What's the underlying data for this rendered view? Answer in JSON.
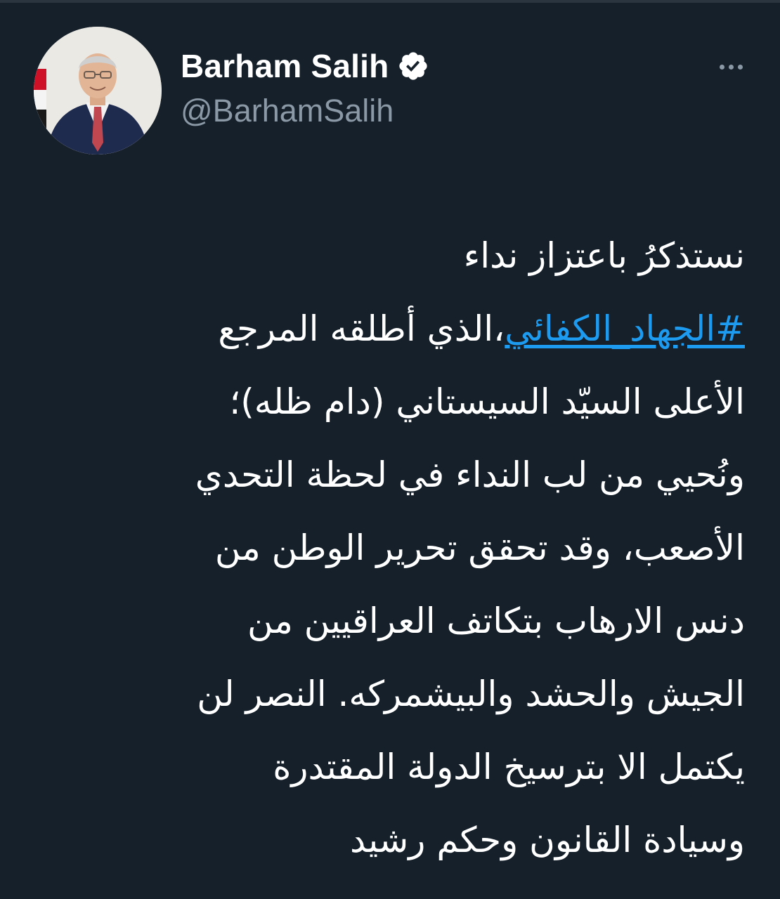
{
  "author": {
    "display_name": "Barham Salih",
    "handle": "@BarhamSalih",
    "verified": true,
    "avatar_icon": "profile-photo"
  },
  "menu": {
    "icon": "more-options-icon"
  },
  "tweet": {
    "line_1": "نستذكرُ باعتزاز نداء",
    "line_2_hashtag": "#الجهاد_الكفائي",
    "line_2_rest": "،الذي أطلقه المرجع",
    "line_3": "الأعلى السيّد السيستاني (دام ظله)؛",
    "line_4": "ونُحيي من لب النداء في لحظة التحدي",
    "line_5": "الأصعب، وقد تحقق تحرير الوطن من",
    "line_6": "دنس الارهاب بتكاتف العراقيين من",
    "line_7": "الجيش والحشد والبيشمركه. النصر لن",
    "line_8": "يكتمل الا بترسيخ الدولة المقتدرة",
    "line_9": "وسيادة القانون وحكم رشيد"
  },
  "colors": {
    "background": "#15202b",
    "text": "#ffffff",
    "secondary_text": "#8b98a5",
    "link": "#1d9bf0",
    "verified_badge": "#ffffff"
  }
}
